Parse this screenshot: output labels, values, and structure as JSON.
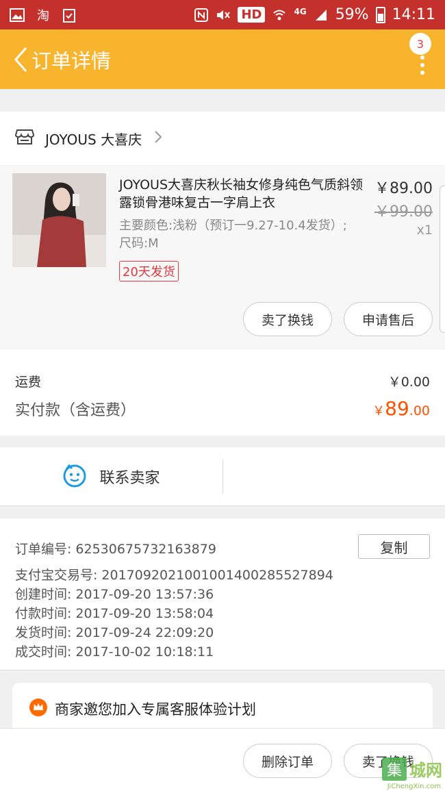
{
  "status_bar": {
    "left_icons": [
      "image-icon",
      "taobao-icon",
      "clipboard-icon"
    ],
    "taobao_glyph": "淘",
    "hd": "HD",
    "network": "4G",
    "battery": "59%",
    "time": "14:11"
  },
  "header": {
    "title": "订单详情",
    "more_badge": "3"
  },
  "shop": {
    "name": "JOYOUS 大喜庆"
  },
  "item": {
    "title": "JOYOUS大喜庆秋长袖女修身纯色气质斜领露锁骨港味复古一字肩上衣",
    "sku": "主要颜色:浅粉（预订一9.27-10.4发货）;尺码:M",
    "tag": "20天发货",
    "price": "￥89.00",
    "original_price": "￥99.00",
    "quantity": "x1",
    "sell_button": "卖了换钱",
    "after_sale_button": "申请售后"
  },
  "totals": {
    "freight_label": "运费",
    "freight_value": "￥0.00",
    "paid_label": "实付款（含运费）",
    "paid_currency": "￥",
    "paid_integer": "89",
    "paid_cents": ".00",
    "accent_color": "#ff5000"
  },
  "contact": {
    "label": "联系卖家"
  },
  "order_info": {
    "order_no_label": "订单编号:",
    "order_no": "62530675732163879",
    "copy_button": "复制",
    "alipay_label": "支付宝交易号:",
    "alipay_no": "2017092021001001400285527894",
    "created_label": "创建时间:",
    "created": "2017-09-20 13:57:36",
    "paid_label": "付款时间:",
    "paid": "2017-09-20 13:58:04",
    "shipped_label": "发货时间:",
    "shipped": "2017-09-24 22:09:20",
    "completed_label": "成交时间:",
    "completed": "2017-10-02 10:18:11"
  },
  "promo": {
    "text": "商家邀您加入专属客服体验计划"
  },
  "bottom_bar": {
    "delete_button": "删除订单",
    "sell_button": "卖了换钱"
  },
  "watermark": {
    "logo": "集",
    "text": "城网",
    "url": "JiChengXin.com"
  },
  "colors": {
    "status_bar": "#c4302b",
    "title_bar": "#f8b42d",
    "tag_red": "#e4393c"
  }
}
